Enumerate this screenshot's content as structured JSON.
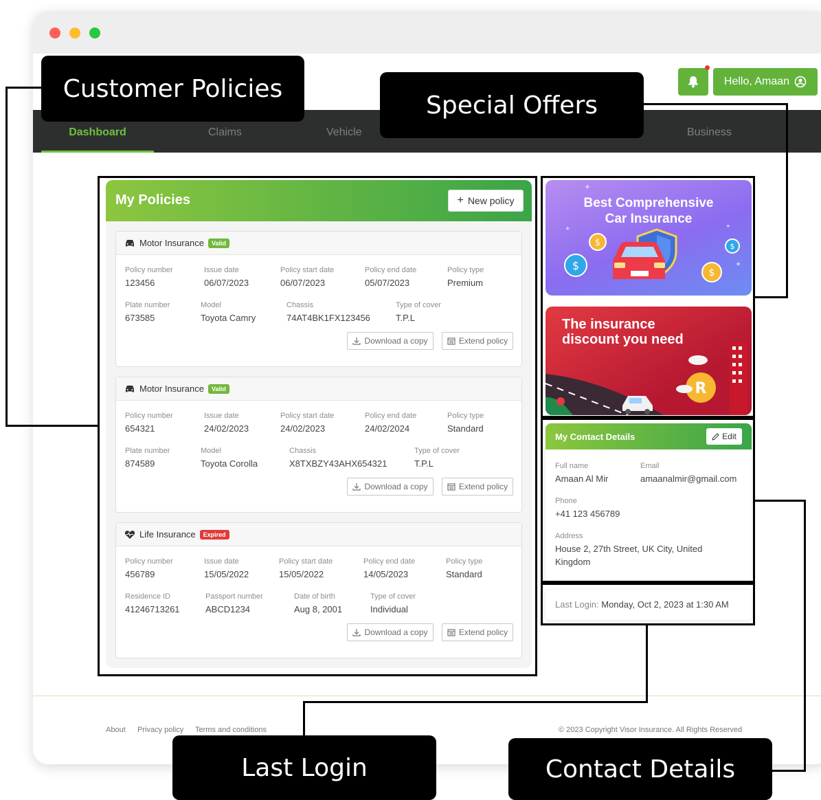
{
  "annotations": {
    "customer_policies": "Customer Policies",
    "special_offers": "Special Offers",
    "last_login": "Last Login",
    "contact_details": "Contact Details"
  },
  "header": {
    "greeting": "Hello, Amaan",
    "notification_icon": "bell-icon",
    "user_icon": "user-circle-icon"
  },
  "nav": {
    "items": [
      {
        "label": "Dashboard",
        "active": true
      },
      {
        "label": "Claims"
      },
      {
        "label": "Vehicle"
      },
      {
        "label": "Business"
      }
    ]
  },
  "policies": {
    "title": "My Policies",
    "new_label": "New policy",
    "download_label": "Download a copy",
    "extend_label": "Extend policy",
    "cards": [
      {
        "name": "Motor Insurance",
        "status": "Valid",
        "row1": [
          {
            "label": "Policy number",
            "value": "123456"
          },
          {
            "label": "Issue date",
            "value": "06/07/2023"
          },
          {
            "label": "Policy start date",
            "value": "06/07/2023"
          },
          {
            "label": "Policy end date",
            "value": "05/07/2023"
          },
          {
            "label": "Policy type",
            "value": "Premium"
          }
        ],
        "row2": [
          {
            "label": "Plate number",
            "value": "673585"
          },
          {
            "label": "Model",
            "value": "Toyota Camry"
          },
          {
            "label": "Chassis",
            "value": "74AT4BK1FX123456"
          },
          {
            "label": "Type of cover",
            "value": "T.P.L"
          }
        ]
      },
      {
        "name": "Motor Insurance",
        "status": "Valid",
        "row1": [
          {
            "label": "Policy number",
            "value": "654321"
          },
          {
            "label": "Issue date",
            "value": "24/02/2023"
          },
          {
            "label": "Policy start date",
            "value": "24/02/2023"
          },
          {
            "label": "Policy end date",
            "value": "24/02/2024"
          },
          {
            "label": "Policy type",
            "value": "Standard"
          }
        ],
        "row2": [
          {
            "label": "Plate number",
            "value": "874589"
          },
          {
            "label": "Model",
            "value": "Toyota Corolla"
          },
          {
            "label": "Chassis",
            "value": "X8TXBZY43AHX654321"
          },
          {
            "label": "Type of cover",
            "value": "T.P.L"
          }
        ]
      },
      {
        "name": "Life Insurance",
        "status": "Expired",
        "row1": [
          {
            "label": "Policy number",
            "value": "456789"
          },
          {
            "label": "Issue date",
            "value": "15/05/2022"
          },
          {
            "label": "Policy start date",
            "value": "15/05/2022"
          },
          {
            "label": "Policy end date",
            "value": "14/05/2023"
          },
          {
            "label": "Policy type",
            "value": "Standard"
          }
        ],
        "row2": [
          {
            "label": "Residence ID",
            "value": "41246713261"
          },
          {
            "label": "Passport number",
            "value": "ABCD1234"
          },
          {
            "label": "Date of birth",
            "value": "Aug 8, 2001"
          },
          {
            "label": "Type of cover",
            "value": "Individual"
          }
        ]
      }
    ]
  },
  "offers": {
    "offer1_title_line1": "Best Comprehensive",
    "offer1_title_line2": "Car Insurance",
    "offer2_title_line1": "The insurance",
    "offer2_title_line2": "discount you need"
  },
  "contact": {
    "title": "My Contact Details",
    "edit_label": "Edit",
    "full_name_label": "Full name",
    "full_name": "Amaan Al Mir",
    "email_label": "Email",
    "email": "amaanalmir@gmail.com",
    "phone_label": "Phone",
    "phone": "+41 123 456789",
    "address_label": "Address",
    "address_line1": "House 2, 27th Street, UK City, United",
    "address_line2": "Kingdom"
  },
  "last_login": {
    "label": "Last Login:",
    "value": "Monday, Oct 2, 2023 at 1:30 AM"
  },
  "footer": {
    "links": [
      "About",
      "Privacy policy",
      "Terms and conditions"
    ],
    "copyright": "© 2023 Copyright Visor Insurance. All Rights Reserved"
  },
  "colors": {
    "brand_green": "#63b33b",
    "nav_dark": "#2c2f2d",
    "valid": "#73b83c",
    "expired": "#e03b3b"
  }
}
